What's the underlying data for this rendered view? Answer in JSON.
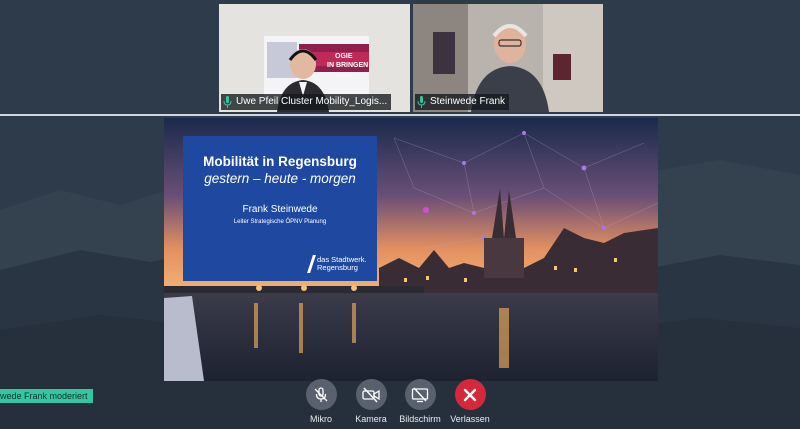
{
  "participants": [
    {
      "name": "Uwe Pfeil Cluster Mobility_Logis..."
    },
    {
      "name": "Steinwede Frank"
    }
  ],
  "slide": {
    "title": "Mobilität in Regensburg",
    "subtitle": "gestern – heute - morgen",
    "presenter": "Frank Steinwede",
    "role": "Leiter Strategische ÖPNV Planung",
    "logo_line1": "das Stadtwerk.",
    "logo_line2": "Regensburg"
  },
  "moderator_notice": "wede Frank moderiert",
  "controls": {
    "mic_label": "Mikro",
    "camera_label": "Kamera",
    "screen_label": "Bildschirm",
    "leave_label": "Verlassen"
  },
  "colors": {
    "accent_green": "#33c6a0",
    "leave_red": "#d6283b",
    "slide_blue": "#1f49a1"
  }
}
